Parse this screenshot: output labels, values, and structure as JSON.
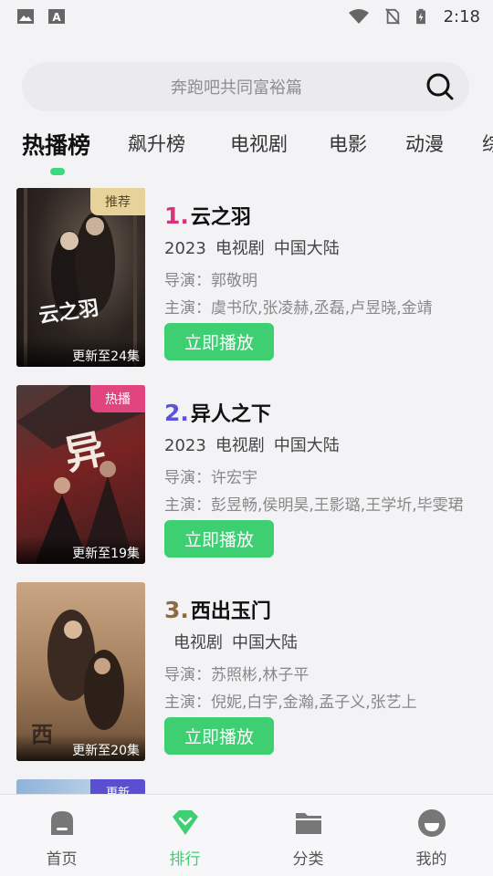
{
  "status_bar": {
    "time": "2:18"
  },
  "search": {
    "placeholder": "奔跑吧共同富裕篇"
  },
  "tabs": [
    {
      "label": "热播榜",
      "active": true
    },
    {
      "label": "飙升榜",
      "active": false
    },
    {
      "label": "电视剧",
      "active": false
    },
    {
      "label": "电影",
      "active": false
    },
    {
      "label": "动漫",
      "active": false
    },
    {
      "label": "综",
      "active": false
    }
  ],
  "items": [
    {
      "rank": "1.",
      "rank_color": "#d6337a",
      "title": "云之羽",
      "year": "2023",
      "type": "电视剧",
      "region": "中国大陆",
      "director": "导演：郭敬明",
      "cast": "主演：虞书欣,张凌赫,丞磊,卢昱晓,金靖",
      "badge": "推荐",
      "badge_color": "#e7d29a",
      "update": "更新至24集",
      "poster_title": "云之羽",
      "play_label": "立即播放"
    },
    {
      "rank": "2.",
      "rank_color": "#5a55d6",
      "title": "异人之下",
      "year": "2023",
      "type": "电视剧",
      "region": "中国大陆",
      "director": "导演：许宏宇",
      "cast": "主演：彭昱畅,侯明昊,王影璐,王学圻,毕雯珺",
      "badge": "热播",
      "badge_color": "#e0457f",
      "update": "更新至19集",
      "poster_title": "异人之下",
      "play_label": "立即播放"
    },
    {
      "rank": "3.",
      "rank_color": "#8b6b47",
      "title": "西出玉门",
      "year": "",
      "type": "电视剧",
      "region": "中国大陆",
      "director": "导演：苏照彬,林子平",
      "cast": "主演：倪妮,白宇,金瀚,孟子义,张艺上",
      "badge": "",
      "badge_color": "",
      "update": "更新至20集",
      "poster_title": "西出",
      "play_label": "立即播放"
    }
  ],
  "peek_badge": "更新",
  "nav": [
    {
      "label": "首页",
      "icon": "home-icon",
      "active": false
    },
    {
      "label": "排行",
      "icon": "ranking-icon",
      "active": true
    },
    {
      "label": "分类",
      "icon": "folder-icon",
      "active": false
    },
    {
      "label": "我的",
      "icon": "profile-icon",
      "active": false
    }
  ],
  "colors": {
    "accent": "#3ecf72",
    "background": "#f3f3f6"
  }
}
